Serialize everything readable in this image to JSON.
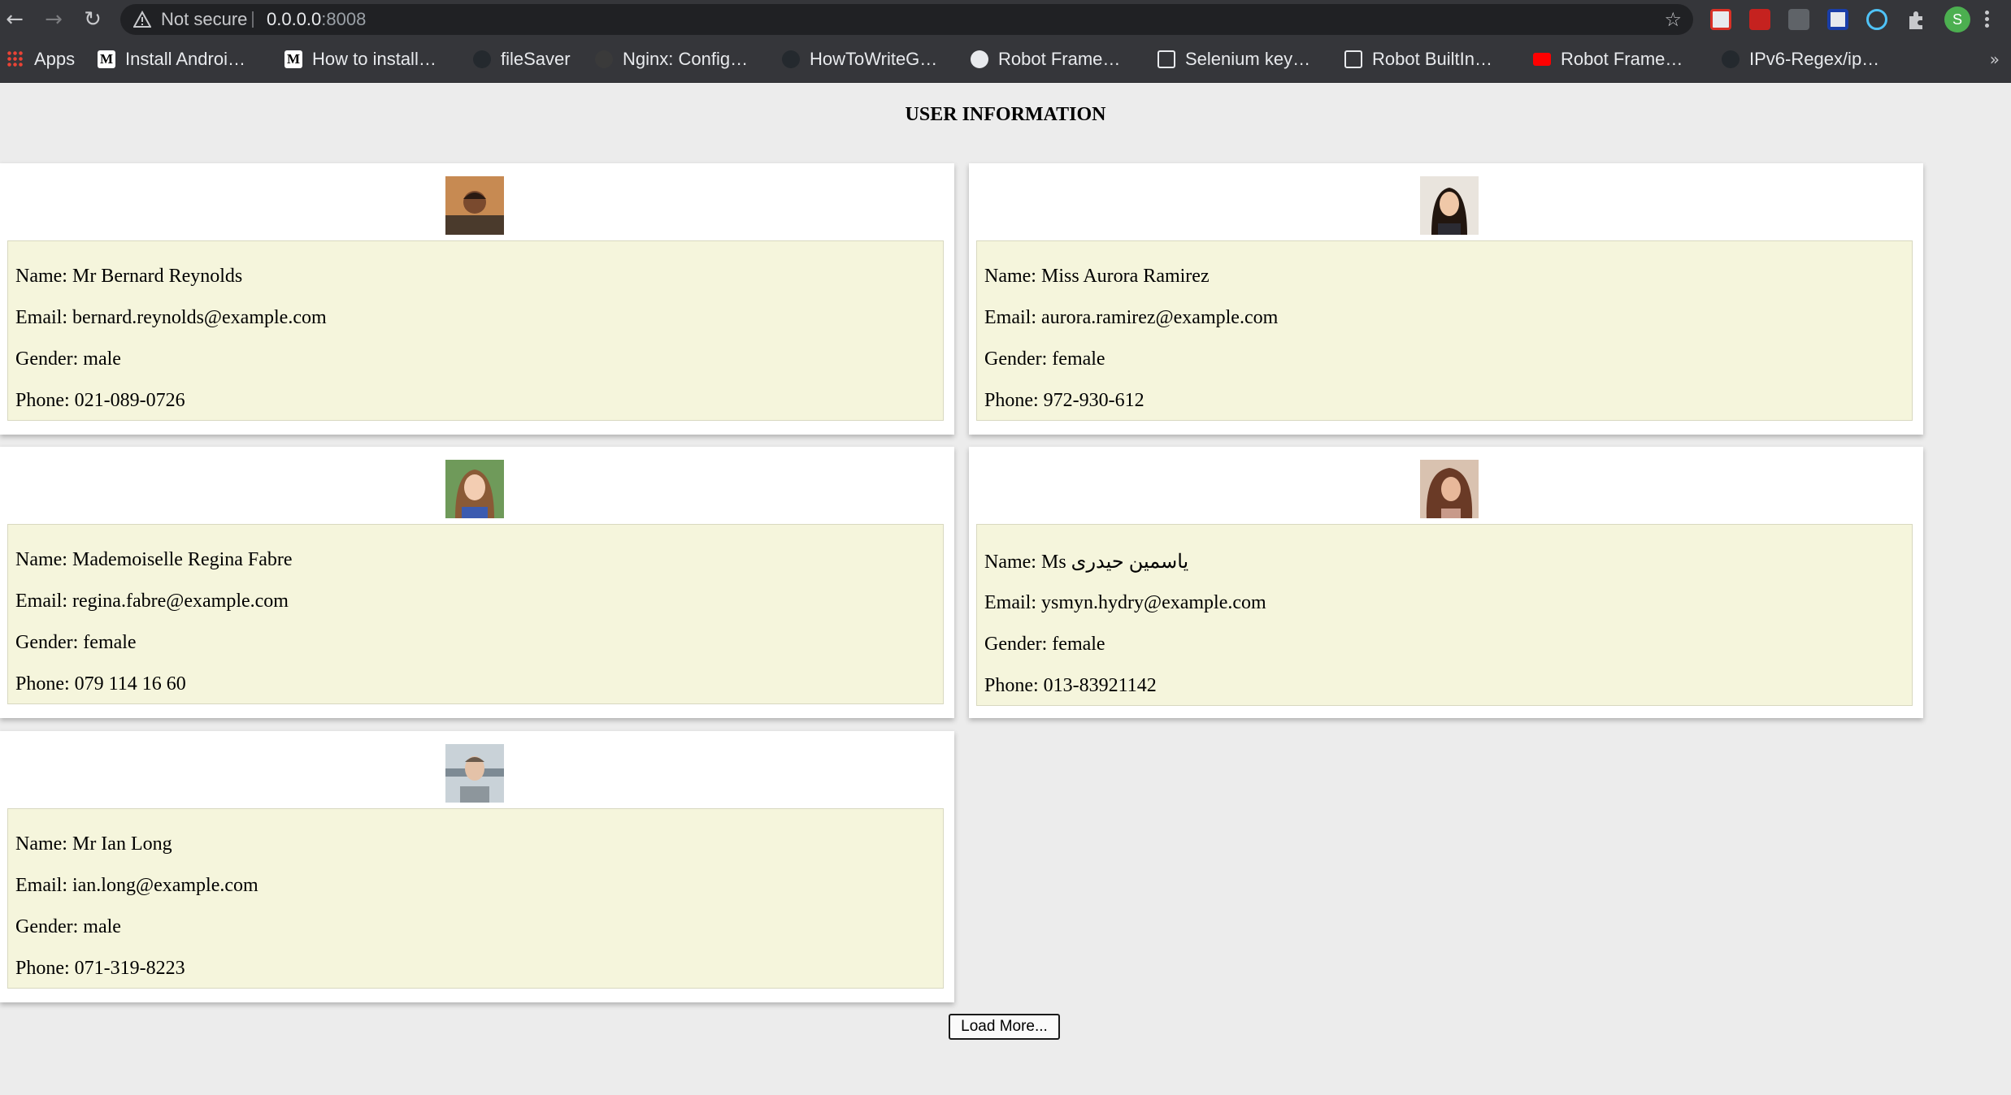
{
  "browser": {
    "security_label": "Not secure",
    "url_host": "0.0.0.0",
    "url_port": ":8008",
    "profile_initial": "S",
    "bookmarks": [
      {
        "label": "Apps",
        "icon": "apps-grid-icon"
      },
      {
        "label": "Install Androi…",
        "icon": "medium-icon"
      },
      {
        "label": "How to install…",
        "icon": "medium-icon"
      },
      {
        "label": "fileSaver",
        "icon": "github-icon"
      },
      {
        "label": "Nginx: Config…",
        "icon": "nginx-icon"
      },
      {
        "label": "HowToWriteG…",
        "icon": "github-icon"
      },
      {
        "label": "Robot Frame…",
        "icon": "globe-icon"
      },
      {
        "label": "Selenium key…",
        "icon": "robot-icon"
      },
      {
        "label": "Robot BuiltIn…",
        "icon": "robot-icon"
      },
      {
        "label": "Robot Frame…",
        "icon": "youtube-icon"
      },
      {
        "label": "IPv6-Regex/ip…",
        "icon": "github-icon"
      }
    ]
  },
  "page": {
    "title": "USER INFORMATION",
    "load_more_label": "Load More..."
  },
  "users": [
    {
      "name": "Name: Mr Bernard Reynolds",
      "email": "Email: bernard.reynolds@example.com",
      "gender": "Gender: male",
      "phone": "Phone: 021-089-0726",
      "photo_color": "#b8784a"
    },
    {
      "name": "Name: Miss Aurora Ramirez",
      "email": "Email: aurora.ramirez@example.com",
      "gender": "Gender: female",
      "phone": "Phone: 972-930-612",
      "photo_color": "#3a2a24"
    },
    {
      "name": "Name: Mademoiselle Regina Fabre",
      "email": "Email: regina.fabre@example.com",
      "gender": "Gender: female",
      "phone": "Phone: 079 114 16 60",
      "photo_color": "#5e8a4a"
    },
    {
      "name": "Name: Ms یاسمین حیدری",
      "email": "Email: ysmyn.hydry@example.com",
      "gender": "Gender: female",
      "phone": "Phone: 013-83921142",
      "photo_color": "#8a5a44"
    },
    {
      "name": "Name: Mr Ian Long",
      "email": "Email: ian.long@example.com",
      "gender": "Gender: male",
      "phone": "Phone: 071-319-8223",
      "photo_color": "#9aa4ac"
    }
  ]
}
